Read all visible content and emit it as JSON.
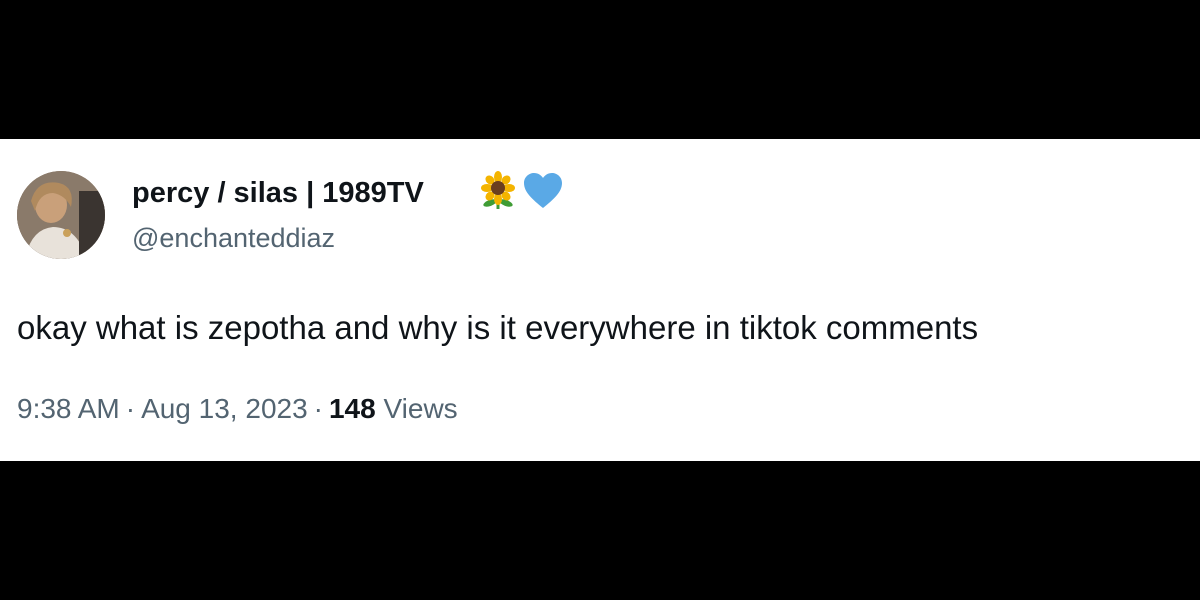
{
  "tweet": {
    "author": {
      "display_name": "percy / silas | 1989TV",
      "handle": "@enchanteddiaz",
      "name_emojis": [
        "sunflower-icon",
        "blue-heart-icon"
      ]
    },
    "text": "okay what is zepotha and why is it everywhere in tiktok comments",
    "meta": {
      "time": "9:38 AM",
      "separator": "·",
      "date": "Aug 13, 2023",
      "views_count": "148",
      "views_label": "Views"
    }
  },
  "colors": {
    "background": "#000000",
    "card": "#ffffff",
    "primary_text": "#0f1419",
    "secondary_text": "#536471",
    "heart": "#5aa9e6",
    "sunflower_petal": "#f4b400",
    "sunflower_center": "#6b3e1f",
    "stem": "#3f9c35"
  }
}
